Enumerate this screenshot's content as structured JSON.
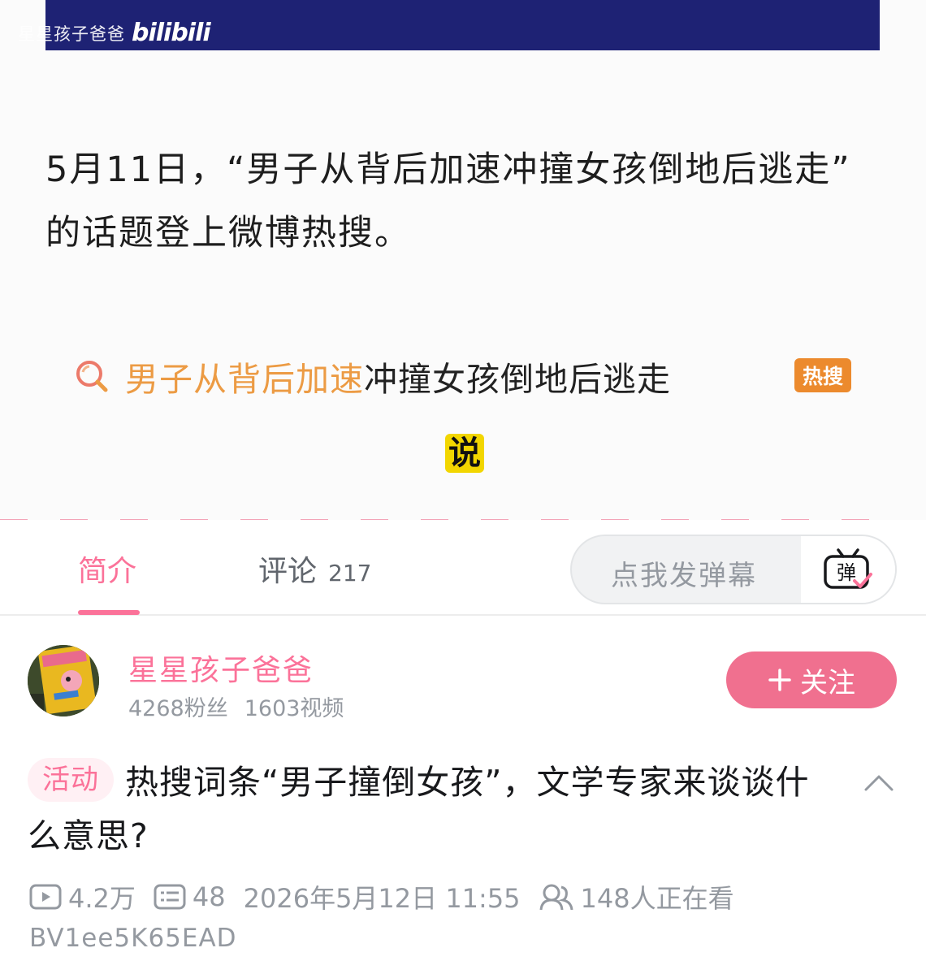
{
  "video": {
    "watermark_author": "星星孩子爸爸",
    "watermark_logo": "bilibili",
    "article_line1": "5月11日，“男子从背后加速冲撞女孩倒地后逃走”",
    "article_line2": "的话题登上微博热搜。",
    "hot_search_highlight": "男子从背后加速",
    "hot_search_rest": "冲撞女孩倒地后逃走",
    "hot_badge": "热搜",
    "subtitle": "说"
  },
  "tabs": {
    "intro_label": "简介",
    "comments_label": "评论",
    "comments_count": "217",
    "danmaku_placeholder": "点我发弹幕",
    "danmaku_icon_char": "弹"
  },
  "uploader": {
    "name": "星星孩子爸爸",
    "followers": "4268粉丝",
    "videos": "1603视频",
    "follow_label": "关注"
  },
  "title": {
    "tag": "活动",
    "text": "热搜词条“男子撞倒女孩”，文学专家来谈谈什么意思?"
  },
  "meta": {
    "views": "4.2万",
    "danmaku_count": "48",
    "publish_time": "2026年5月12日 11:55",
    "watching": "148人正在看",
    "bvid": "BV1ee5K65EAD"
  },
  "colors": {
    "brand_pink": "#fb7299",
    "follow_pink": "#f0708f",
    "video_topbar": "#1e2274",
    "hot_orange": "#ec9b44",
    "subtitle_yellow": "#f2d600"
  },
  "icons": [
    "search-icon",
    "danmaku-toggle-icon",
    "plus-icon",
    "chevron-up-icon",
    "play-count-icon",
    "danmaku-count-icon",
    "viewers-icon"
  ]
}
